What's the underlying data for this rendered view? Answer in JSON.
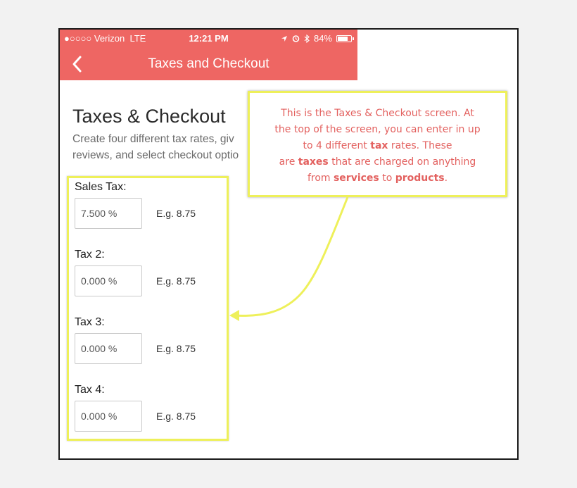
{
  "status_bar": {
    "carrier": "●○○○○ Verizon",
    "network": "LTE",
    "time": "12:21 PM",
    "battery": "84%",
    "battery_level": 0.84
  },
  "navbar": {
    "title": "Taxes and Checkout",
    "back_icon": "chevron-left-icon"
  },
  "page": {
    "title": "Taxes & Checkout",
    "description_line1": "Create four different tax rates, giv",
    "description_line2": "reviews, and select checkout optio"
  },
  "taxes": [
    {
      "label": "Sales Tax:",
      "value": "7.500 %",
      "hint": "E.g. 8.75"
    },
    {
      "label": "Tax 2:",
      "value": "0.000 %",
      "hint": "E.g. 8.75"
    },
    {
      "label": "Tax 3:",
      "value": "0.000 %",
      "hint": "E.g. 8.75"
    },
    {
      "label": "Tax 4:",
      "value": "0.000 %",
      "hint": "E.g. 8.75"
    }
  ],
  "callout": {
    "l1": "This is the Taxes & Checkout screen. At",
    "l2": "the top of the screen, you can enter in up",
    "l3_a": "to 4 different ",
    "l3_b": "tax",
    "l3_c": " rates. These",
    "l4_a": "are ",
    "l4_b": "taxes",
    "l4_c": " that are charged on anything",
    "l5_a": "from ",
    "l5_b": "services",
    "l5_c": " to ",
    "l5_d": "products",
    "l5_e": "."
  },
  "colors": {
    "brand": "#ee6663",
    "highlight": "#eef05a",
    "callout_text": "#e3615f"
  }
}
